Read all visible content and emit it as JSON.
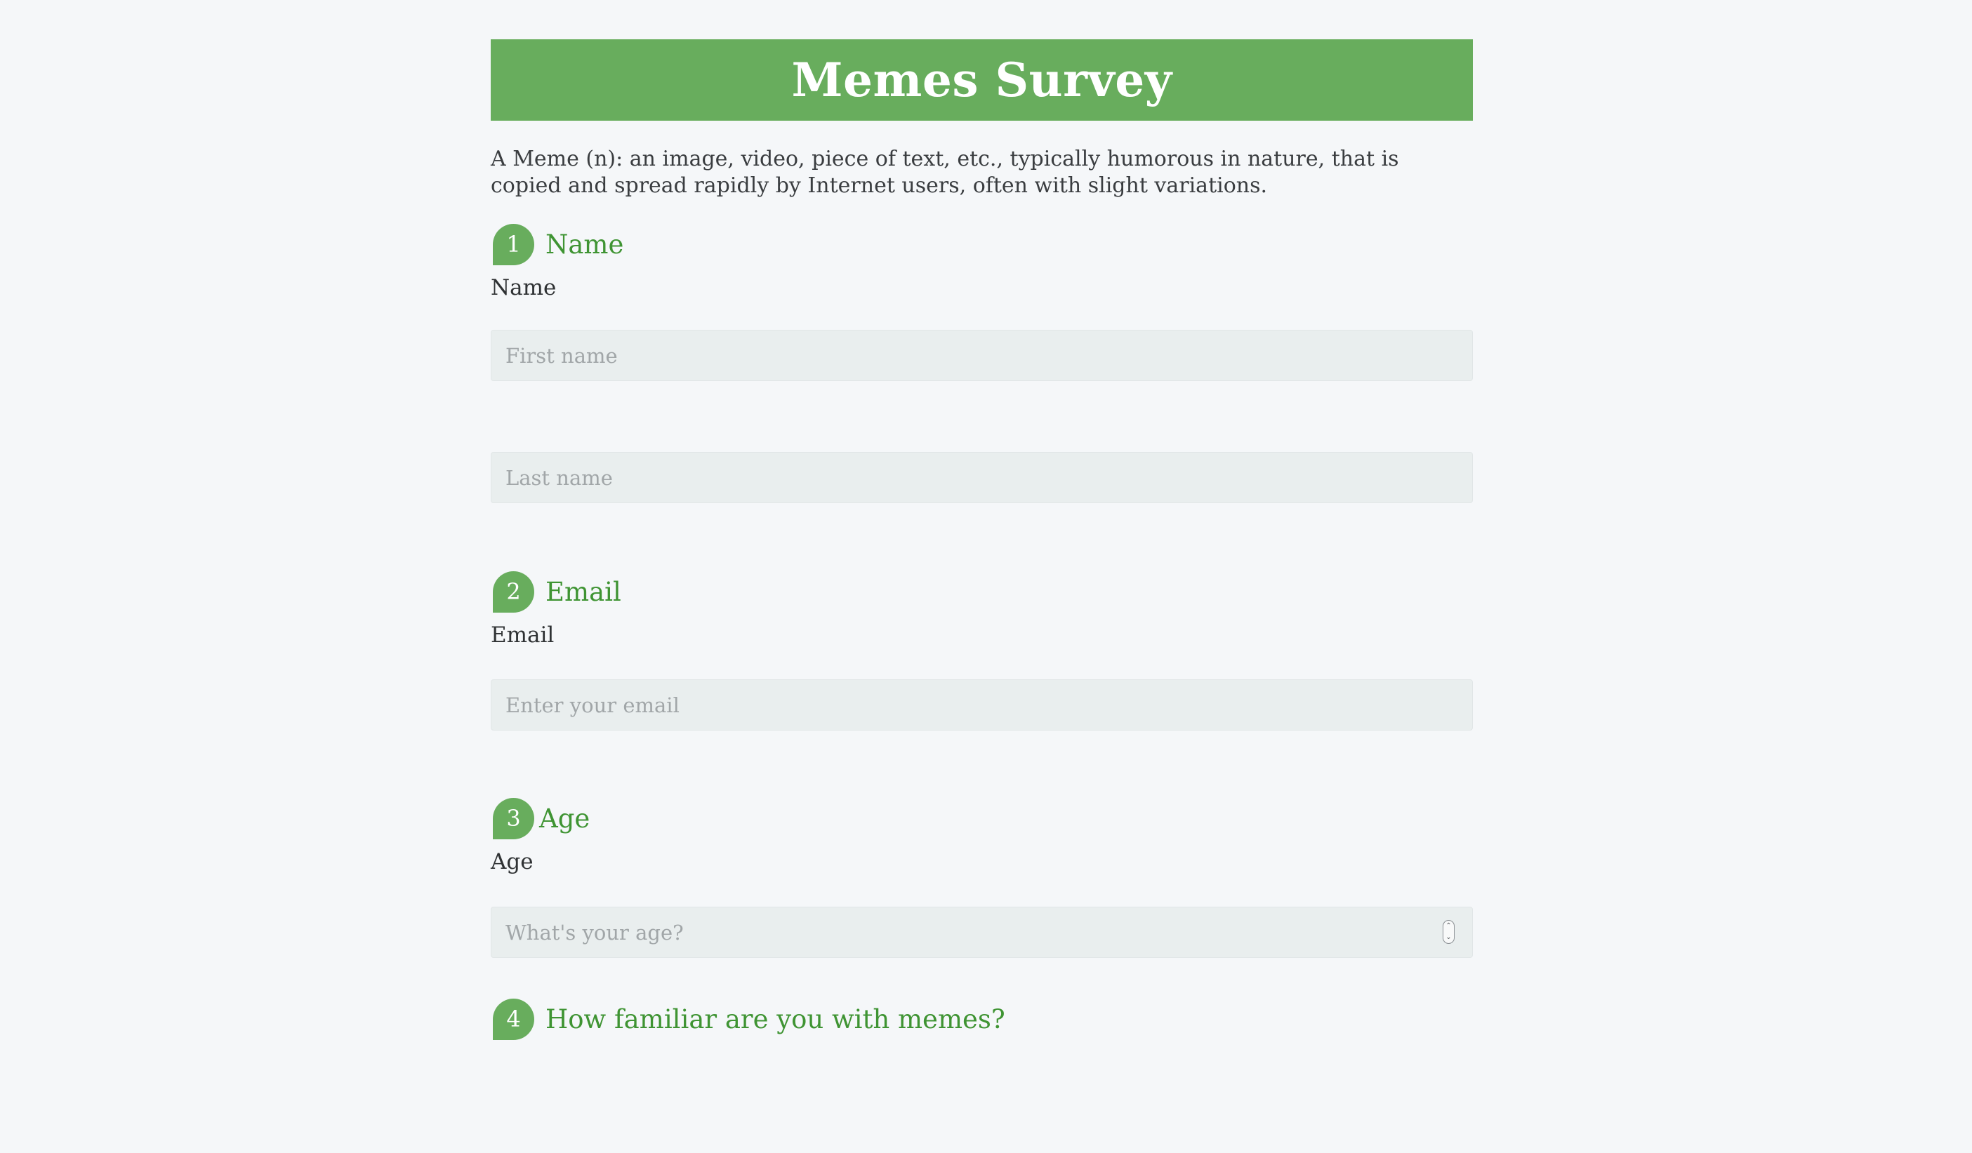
{
  "header": {
    "title": "Memes Survey"
  },
  "intro": "A Meme (n): an image, video, piece of text, etc., typically humorous in nature, that is copied and spread rapidly by Internet users, often with slight variations.",
  "questions": [
    {
      "number": "1",
      "title": "Name",
      "label": "Name",
      "first_name_placeholder": "First name",
      "last_name_placeholder": "Last name"
    },
    {
      "number": "2",
      "title": "Email",
      "label": "Email",
      "placeholder": "Enter your email"
    },
    {
      "number": "3",
      "title": "Age",
      "label": "Age",
      "placeholder": "What's your age?"
    },
    {
      "number": "4",
      "title": "How familiar are you with memes?"
    }
  ],
  "colors": {
    "accent": "#68ad5d",
    "heading_green": "#3f9433",
    "background": "#f5f7f9",
    "input_bg": "#e9eeee"
  },
  "icons": {
    "spinner": "number-stepper-icon"
  }
}
